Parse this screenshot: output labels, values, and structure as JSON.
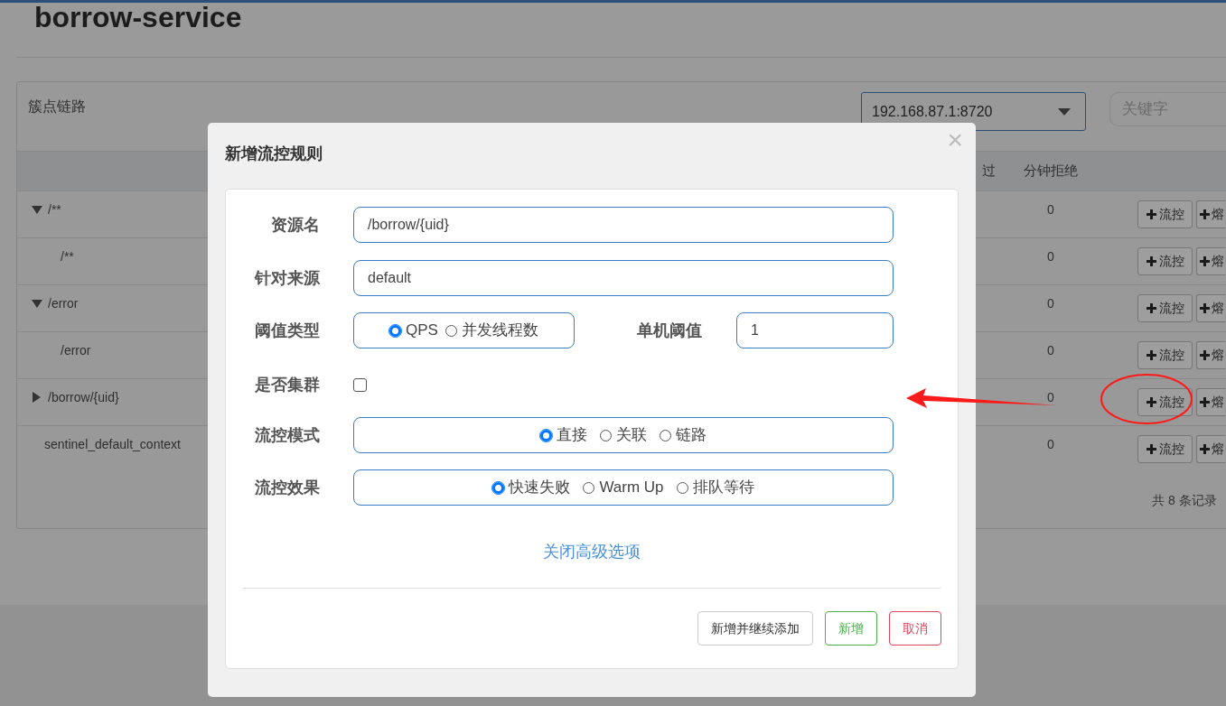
{
  "page": {
    "title": "borrow-service"
  },
  "panel": {
    "title": "簇点链路",
    "machine_select": {
      "value": "192.168.87.1:8720"
    },
    "search": {
      "placeholder": "关键字"
    },
    "columns": [
      {
        "label": "过"
      },
      {
        "label": "分钟拒绝"
      }
    ],
    "rows": [
      {
        "name": "/**",
        "expanded": true,
        "rejected": "0",
        "flow_button": "流控",
        "degrade_button": "熔",
        "children": [
          {
            "name": "/**",
            "rejected": "0",
            "flow_button": "流控",
            "degrade_button": "熔"
          }
        ]
      },
      {
        "name": "/error",
        "expanded": true,
        "rejected": "0",
        "flow_button": "流控",
        "degrade_button": "熔",
        "children": [
          {
            "name": "/error",
            "rejected": "0",
            "flow_button": "流控",
            "degrade_button": "熔"
          }
        ]
      },
      {
        "name": "/borrow/{uid}",
        "expanded": false,
        "rejected": "0",
        "flow_button": "流控",
        "degrade_button": "熔",
        "children": []
      },
      {
        "name": "sentinel_default_context",
        "rejected": "0",
        "flow_button": "流控",
        "degrade_button": "熔"
      }
    ],
    "footer": "共 8 条记录"
  },
  "dialog": {
    "title": "新增流控规则",
    "close": "×",
    "fields": [
      {
        "kind": "text",
        "label": "资源名",
        "value": "/borrow/{uid}"
      },
      {
        "kind": "text",
        "label": "针对来源",
        "value": "default"
      },
      {
        "kind": "threshold",
        "label": "阈值类型",
        "options": [
          {
            "label": "QPS",
            "selected": true
          },
          {
            "label": "并发线程数",
            "selected": false
          }
        ],
        "extra_label": "单机阈值",
        "extra_value": "1"
      },
      {
        "kind": "checkbox",
        "label": "是否集群",
        "checked": false
      },
      {
        "kind": "radio",
        "label": "流控模式",
        "options": [
          {
            "label": "直接",
            "selected": true
          },
          {
            "label": "关联",
            "selected": false
          },
          {
            "label": "链路",
            "selected": false
          }
        ]
      },
      {
        "kind": "radio",
        "label": "流控效果",
        "options": [
          {
            "label": "快速失败",
            "selected": true
          },
          {
            "label": "Warm Up",
            "selected": false
          },
          {
            "label": "排队等待",
            "selected": false
          }
        ]
      }
    ],
    "toggle_link": "关闭高级选项",
    "buttons": [
      {
        "label": "新增并继续添加",
        "kind": "default"
      },
      {
        "label": "新增",
        "kind": "success"
      },
      {
        "label": "取消",
        "kind": "danger"
      }
    ]
  }
}
